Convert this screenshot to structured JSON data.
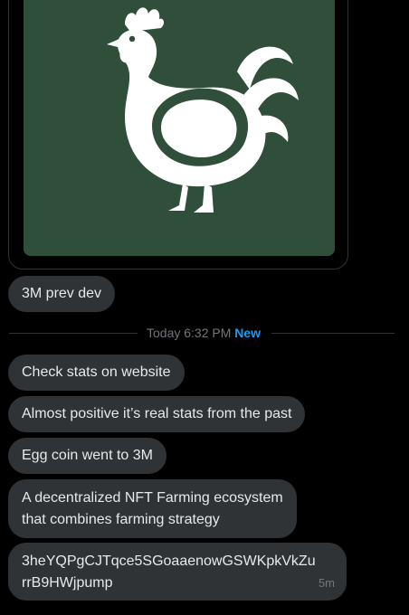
{
  "colors": {
    "background": "#000000",
    "bubble": "#2f3336",
    "text": "#e7e9ea",
    "muted": "#71767b",
    "accent": "#1d9bf0",
    "media_green": "#2f4f3a"
  },
  "media": {
    "icon": "rooster-icon"
  },
  "messages_before": [
    {
      "text": "3M prev dev"
    }
  ],
  "divider": {
    "time": "Today 6:32 PM",
    "new_label": "New"
  },
  "messages_after": [
    {
      "text": "Check stats on website"
    },
    {
      "text": "Almost positive it’s real stats from the past"
    },
    {
      "text": "Egg coin went to 3M"
    },
    {
      "lines": [
        "A decentralized NFT Farming ecosystem",
        "that combines farming strategy"
      ]
    },
    {
      "lines": [
        "3heYQPgCJTqce5SGoaaenowGSWKpkVkZu",
        "rrB9HWjpump"
      ],
      "timestamp": "5m"
    }
  ]
}
